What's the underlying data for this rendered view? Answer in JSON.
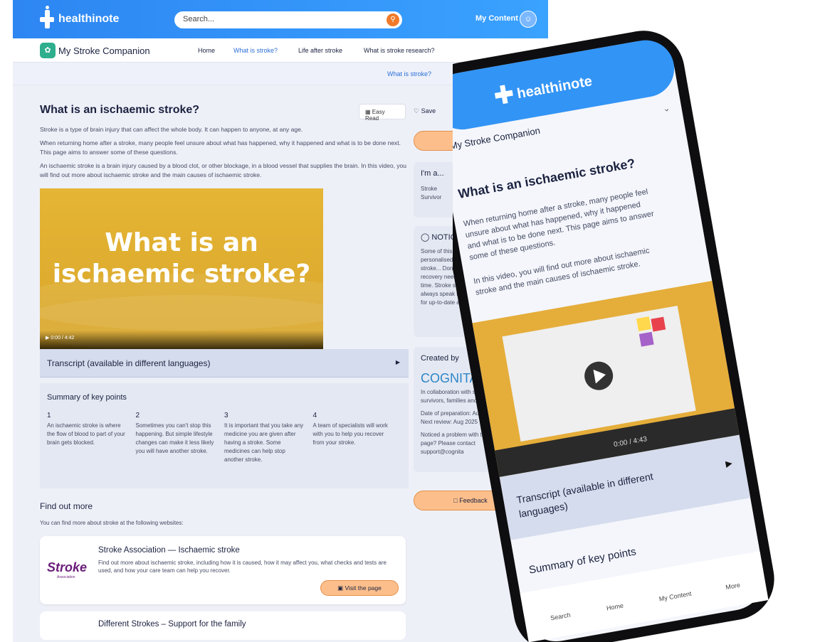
{
  "header": {
    "logo": "healthinote",
    "search_placeholder": "Search...",
    "my_content": "My Content"
  },
  "nav": {
    "brand": "My Stroke Companion",
    "links": [
      "Home",
      "What is stroke?",
      "Life after stroke",
      "What is stroke research?"
    ]
  },
  "breadcrumb": "What is stroke?",
  "page": {
    "title": "What is an ischaemic stroke?",
    "easy_read": "Easy Read",
    "p1": "Stroke is a type of brain injury that can affect the whole body. It can happen to anyone, at any age.",
    "p2": "When returning home after a stroke, many people feel unsure about what has happened, why it happened and what is to be done next. This page aims to answer some of these questions.",
    "p3": "An ischaemic stroke is a brain injury caused by a blood clot, or other blockage, in a blood vessel that supplies the brain. In this video, you will find out more about ischaemic stroke and the main causes of ischaemic stroke.",
    "video_title": "What is an ischaemic stroke?",
    "video_time": "0:00 / 4:42",
    "transcript": "Transcript (available in different languages)",
    "summary_title": "Summary of key points",
    "points": [
      {
        "num": "1",
        "text": "An ischaemic stroke is where the flow of blood to part of your brain gets blocked."
      },
      {
        "num": "2",
        "text": "Sometimes you can't stop this happening. But simple lifestyle changes can make it less likely you will have another stroke."
      },
      {
        "num": "3",
        "text": "It is important that you take any medicine you are given after having a stroke. Some medicines can help stop another stroke."
      },
      {
        "num": "4",
        "text": "A team of specialists will work with you to help you recover from your stroke."
      }
    ],
    "find_more": "Find out more",
    "find_more_sub": "You can find more about stroke at the following websites:",
    "card1": {
      "logo": "Stroke",
      "logo_sub": "Association",
      "title": "Stroke Association — Ischaemic stroke",
      "desc": "Find out more about ischaemic stroke, including how it is caused, how it may affect you, what checks and tests are used, and how your care team can help you recover.",
      "button": "Visit the page"
    },
    "card2": {
      "title": "Different Strokes – Support for the family"
    }
  },
  "sidebar": {
    "save": "Save",
    "iam": "I'm a...",
    "role": "Stroke Survivor",
    "notice_title": "NOTICE",
    "notice_text": "Some of this content has been personalised... relevant to all stroke... Don't forget that my recovery needs will change over time. Stroke survivors should always speak to their care team for up-to-date advice.",
    "created_by": "Created by",
    "creator": "COGNITA",
    "collab": "In collaboration with stroke survivors, families and carers",
    "prep": "Date of preparation: Aug 2023",
    "review": "Next review: Aug 2025",
    "problem": "Noticed a problem with this page? Please contact support@cognita",
    "feedback": "Feedback"
  },
  "phone": {
    "logo": "healthinote",
    "brand": "My Stroke Companion",
    "title": "What is an ischaemic stroke?",
    "p1": "When returning home after a stroke, many people feel unsure about what has happened, why it happened and what is to be done next. This page aims to answer some of these questions.",
    "p2": "In this video, you will find out more about ischaemic stroke and the main causes of ischaemic stroke.",
    "video_time": "0:00 / 4:43",
    "transcript": "Transcript (available in different languages)",
    "summary": "Summary of key points",
    "tabs": [
      "Search",
      "Home",
      "My Content",
      "More"
    ]
  }
}
